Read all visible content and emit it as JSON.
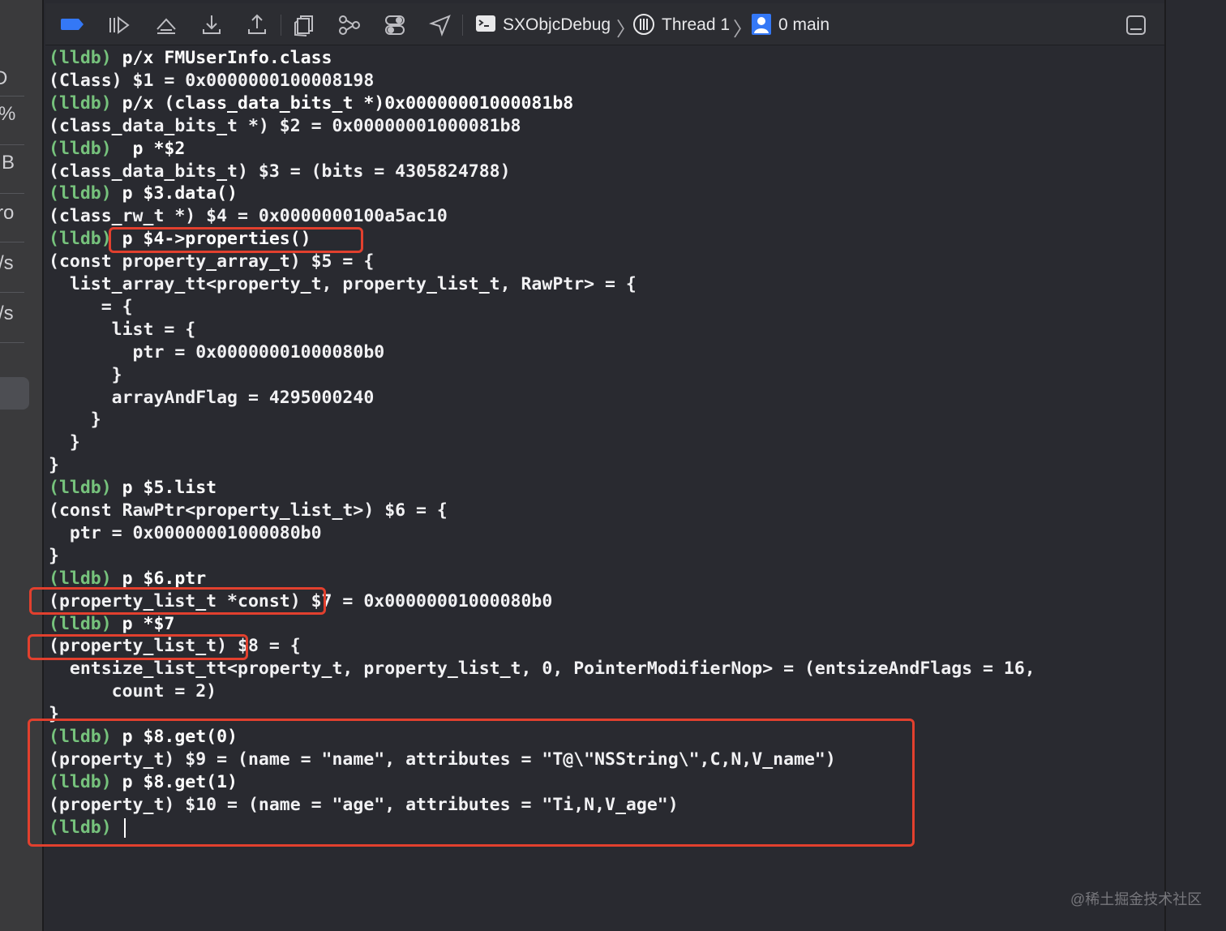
{
  "sidebar": {
    "items": [
      {
        "glyph": "D",
        "name": "sidebar-item-1"
      },
      {
        "glyph": "%",
        "name": "sidebar-item-2"
      },
      {
        "glyph": "B",
        "name": "sidebar-item-3"
      },
      {
        "glyph": "ro",
        "name": "sidebar-item-4"
      },
      {
        "glyph": "/s",
        "name": "sidebar-item-5"
      },
      {
        "glyph": "/s",
        "name": "sidebar-item-6"
      }
    ]
  },
  "toolbar": {
    "icons": [
      "breakpoints-toggle-icon",
      "continue-icon",
      "step-over-icon",
      "step-into-icon",
      "step-out-icon",
      "view-hierarchy-icon",
      "memory-graph-icon",
      "environment-overrides-icon",
      "simulate-location-icon"
    ],
    "breadcrumb": {
      "target": "SXObjcDebug",
      "thread": "Thread 1",
      "frame": "0 main"
    }
  },
  "console": {
    "lines": [
      {
        "prompt": "(lldb)",
        "text": " p/x FMUserInfo.class"
      },
      {
        "prompt": "",
        "text": "(Class) $1 = 0x0000000100008198"
      },
      {
        "prompt": "(lldb)",
        "text": " p/x (class_data_bits_t *)0x00000001000081b8"
      },
      {
        "prompt": "",
        "text": "(class_data_bits_t *) $2 = 0x00000001000081b8"
      },
      {
        "prompt": "(lldb)",
        "text": "  p *$2"
      },
      {
        "prompt": "",
        "text": "(class_data_bits_t) $3 = (bits = 4305824788)"
      },
      {
        "prompt": "(lldb)",
        "text": " p $3.data()"
      },
      {
        "prompt": "",
        "text": "(class_rw_t *) $4 = 0x0000000100a5ac10"
      },
      {
        "prompt": "(lldb)",
        "text": " p $4->properties()"
      },
      {
        "prompt": "",
        "text": "(const property_array_t) $5 = {"
      },
      {
        "prompt": "",
        "text": "  list_array_tt<property_t, property_list_t, RawPtr> = {"
      },
      {
        "prompt": "",
        "text": "     = {"
      },
      {
        "prompt": "",
        "text": "      list = {"
      },
      {
        "prompt": "",
        "text": "        ptr = 0x00000001000080b0"
      },
      {
        "prompt": "",
        "text": "      }"
      },
      {
        "prompt": "",
        "text": "      arrayAndFlag = 4295000240"
      },
      {
        "prompt": "",
        "text": "    }"
      },
      {
        "prompt": "",
        "text": "  }"
      },
      {
        "prompt": "",
        "text": "}"
      },
      {
        "prompt": "(lldb)",
        "text": " p $5.list"
      },
      {
        "prompt": "",
        "text": "(const RawPtr<property_list_t>) $6 = {"
      },
      {
        "prompt": "",
        "text": "  ptr = 0x00000001000080b0"
      },
      {
        "prompt": "",
        "text": "}"
      },
      {
        "prompt": "(lldb)",
        "text": " p $6.ptr"
      },
      {
        "prompt": "",
        "text": "(property_list_t *const) $7 = 0x00000001000080b0"
      },
      {
        "prompt": "(lldb)",
        "text": " p *$7"
      },
      {
        "prompt": "",
        "text": "(property_list_t) $8 = {"
      },
      {
        "prompt": "",
        "text": "  entsize_list_tt<property_t, property_list_t, 0, PointerModifierNop> = (entsizeAndFlags = 16,"
      },
      {
        "prompt": "",
        "text": "      count = 2)"
      },
      {
        "prompt": "",
        "text": "}"
      },
      {
        "prompt": "(lldb)",
        "text": " p $8.get(0)"
      },
      {
        "prompt": "",
        "text": "(property_t) $9 = (name = \"name\", attributes = \"T@\\\"NSString\\\",C,N,V_name\")"
      },
      {
        "prompt": "(lldb)",
        "text": " p $8.get(1)"
      },
      {
        "prompt": "",
        "text": "(property_t) $10 = (name = \"age\", attributes = \"Ti,N,V_age\")"
      },
      {
        "prompt": "(lldb)",
        "text": " "
      }
    ]
  },
  "watermark": "@稀土掘金技术社区",
  "colors": {
    "background": "#292a30",
    "prompt": "#76c27c",
    "highlight": "#e2402e",
    "toolbar_accent": "#3478f6"
  }
}
